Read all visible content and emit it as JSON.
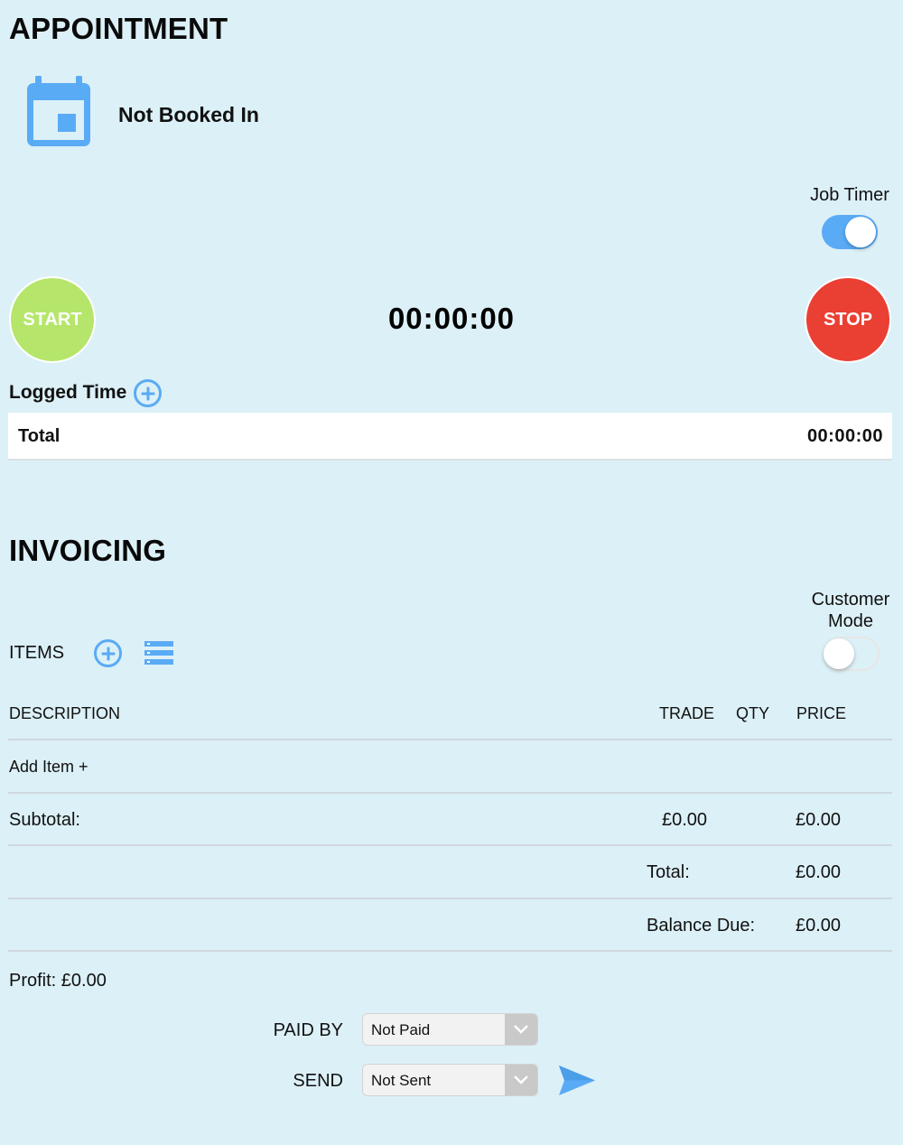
{
  "appointment": {
    "title": "APPOINTMENT",
    "status": "Not Booked In",
    "icon": "calendar-icon"
  },
  "job_timer": {
    "label": "Job Timer",
    "enabled": true,
    "start_label": "START",
    "stop_label": "STOP",
    "display": "00:00:00",
    "colors": {
      "start": "#b5e66b",
      "stop": "#ea3f33",
      "accent": "#5aabf5"
    }
  },
  "logged_time": {
    "label": "Logged Time",
    "add_icon": "plus-circle-icon",
    "total_label": "Total",
    "total_value": "00:00:00"
  },
  "invoicing": {
    "title": "INVOICING",
    "customer_mode_label_line1": "Customer",
    "customer_mode_label_line2": "Mode",
    "customer_mode_enabled": false,
    "items_label": "ITEMS",
    "add_icon": "plus-circle-icon",
    "list_icon": "list-icon",
    "columns": {
      "description": "DESCRIPTION",
      "trade": "TRADE",
      "qty": "QTY",
      "price": "PRICE"
    },
    "add_item_label": "Add Item +",
    "subtotal": {
      "label": "Subtotal:",
      "trade": "£0.00",
      "price": "£0.00"
    },
    "total": {
      "label": "Total:",
      "value": "£0.00"
    },
    "balance_due": {
      "label": "Balance Due:",
      "value": "£0.00"
    },
    "profit": "Profit: £0.00",
    "paid_by": {
      "label": "PAID BY",
      "value": "Not Paid"
    },
    "send": {
      "label": "SEND",
      "value": "Not Sent",
      "icon": "send-icon"
    }
  }
}
